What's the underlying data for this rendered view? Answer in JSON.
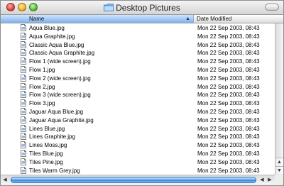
{
  "window": {
    "title": "Desktop Pictures"
  },
  "columns": {
    "name": "Name",
    "date_modified": "Date Modified",
    "sorted_by": "Name"
  },
  "files": [
    {
      "name": "Aqua Blue.jpg",
      "date": "Mon 22 Sep 2003, 08:43"
    },
    {
      "name": "Aqua Graphite.jpg",
      "date": "Mon 22 Sep 2003, 08:43"
    },
    {
      "name": "Classic Aqua Blue.jpg",
      "date": "Mon 22 Sep 2003, 08:43"
    },
    {
      "name": "Classic Aqua Graphite.jpg",
      "date": "Mon 22 Sep 2003, 08:43"
    },
    {
      "name": "Flow 1 (wide screen).jpg",
      "date": "Mon 22 Sep 2003, 08:43"
    },
    {
      "name": "Flow 1.jpg",
      "date": "Mon 22 Sep 2003, 08:43"
    },
    {
      "name": "Flow 2 (wide screen).jpg",
      "date": "Mon 22 Sep 2003, 08:43"
    },
    {
      "name": "Flow 2.jpg",
      "date": "Mon 22 Sep 2003, 08:43"
    },
    {
      "name": "Flow 3 (wide screen).jpg",
      "date": "Mon 22 Sep 2003, 08:43"
    },
    {
      "name": "Flow 3.jpg",
      "date": "Mon 22 Sep 2003, 08:43"
    },
    {
      "name": "Jaguar Aqua Blue.jpg",
      "date": "Mon 22 Sep 2003, 08:43"
    },
    {
      "name": "Jaguar Aqua Graphite.jpg",
      "date": "Mon 22 Sep 2003, 08:43"
    },
    {
      "name": "Lines Blue.jpg",
      "date": "Mon 22 Sep 2003, 08:43"
    },
    {
      "name": "Lines Graphite.jpg",
      "date": "Mon 22 Sep 2003, 08:43"
    },
    {
      "name": "Lines Moss.jpg",
      "date": "Mon 22 Sep 2003, 08:43"
    },
    {
      "name": "Tiles Blue.jpg",
      "date": "Mon 22 Sep 2003, 08:43"
    },
    {
      "name": "Tiles Pine.jpg",
      "date": "Mon 22 Sep 2003, 08:43"
    },
    {
      "name": "Tiles Warm Grey.jpg",
      "date": "Mon 22 Sep 2003, 08:43"
    }
  ],
  "icons": {
    "window_folder": "folder-icon",
    "file": "jpeg-document-icon",
    "sort": "sort-ascending-icon",
    "scroll_left": "scroll-left-arrow-icon",
    "scroll_right": "scroll-right-arrow-icon",
    "scroll_up": "scroll-up-arrow-icon",
    "scroll_down": "scroll-down-arrow-icon"
  },
  "colors": {
    "window_close": "#e1453a",
    "window_minimize": "#f3b32a",
    "window_zoom": "#5ebd3b",
    "sorted_column_header": "#7fb2ea",
    "scroll_thumb": "#2d7fd8"
  },
  "horizontal_scroll": {
    "visible_fraction": 1.0
  }
}
